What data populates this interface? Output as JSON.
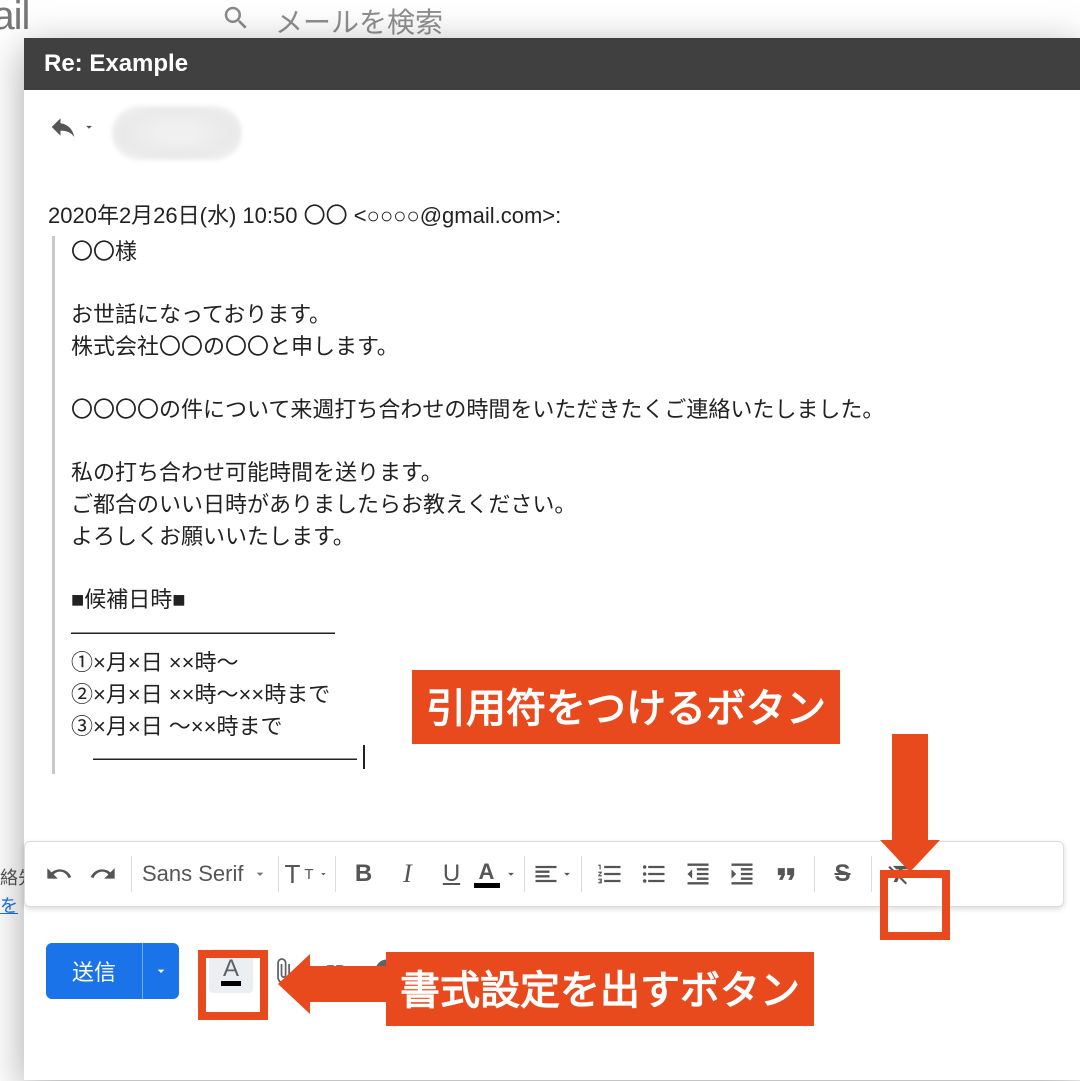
{
  "bg": {
    "logo_fragment": "mail",
    "search_placeholder": "メールを検索"
  },
  "sidebar_cut": {
    "line1": "絡先",
    "line2": "を"
  },
  "compose": {
    "title": "Re: Example",
    "quote_header": "2020年2月26日(水) 10:50 〇〇 <○○○○@gmail.com>:",
    "lines": [
      "〇〇様",
      "",
      "お世話になっております。",
      "株式会社〇〇の〇〇と申します。",
      "",
      "〇〇〇〇の件について来週打ち合わせの時間をいただきたくご連絡いたしました。",
      "",
      "私の打ち合わせ可能時間を送ります。",
      "ご都合のいい日時がありましたらお教えください。",
      "よろしくお願いいたします。",
      "",
      "■候補日時■",
      "――――――――――――",
      "①×月×日 ××時～",
      "②×月×日 ××時～××時まで",
      "③×月×日 ～××時まで",
      "　――――――――――――"
    ]
  },
  "format": {
    "font": "Sans Serif",
    "size_big": "T",
    "size_small": "T",
    "bold": "B",
    "italic": "I",
    "underline": "U",
    "color_letter": "A",
    "strike": "S"
  },
  "send": {
    "label": "送信"
  },
  "annot": {
    "quote_label": "引用符をつけるボタン",
    "format_label": "書式設定を出すボタン"
  }
}
